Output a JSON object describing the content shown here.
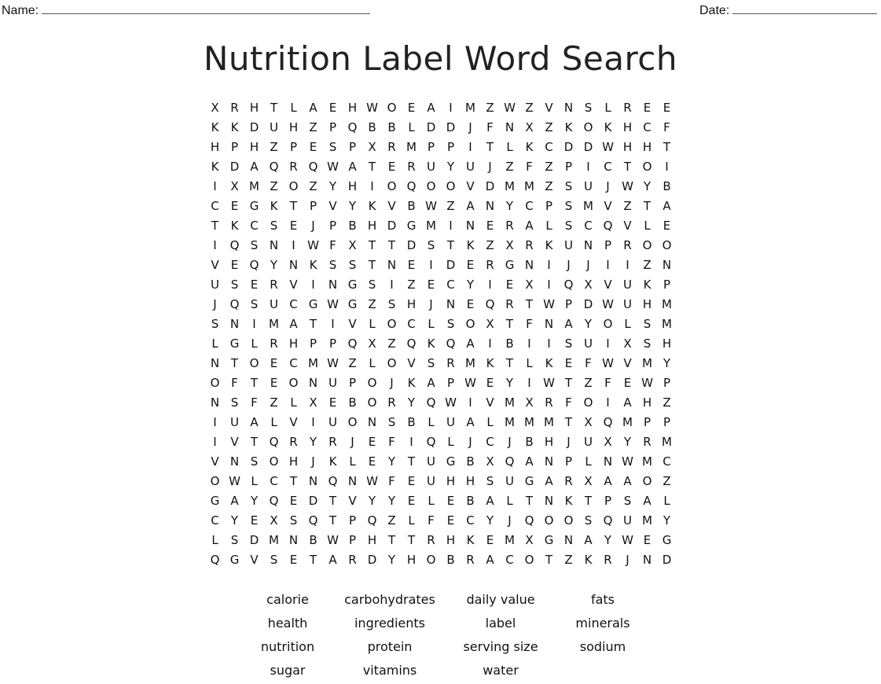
{
  "header": {
    "name_label": "Name:",
    "date_label": "Date:"
  },
  "title": "Nutrition Label Word Search",
  "grid": [
    "XRHTLAEHWOEAIMZWZVNSLREE",
    "KKDUHZPQBBLDDJFNXZKOKHCF",
    "HPHZPESPXRMPPITLKCDDWHHT",
    "KDAQRQWATERUYUJZFZPICTOI",
    "IXMZOZYHIOQOOVDMMZSUJWYB",
    "CEGKTPVYKVBWZANYCPSMVZTA",
    "TKCSEJPBHDGMINERALSCQVLE",
    "IQSNIWFXTTDSTKZXRKUNPROO",
    "VEQYNKSSTNEIDERGNIJJIIZN",
    "USERVINGSIZECYIEXIQXVUKP",
    "JQSUCGWGZSHJNEQRTWPDWUHM",
    "SNIMATIVLOCLSOXTFNAYOLSM",
    "LGLRHPPQXZQKQAIBIISUIXSH",
    "NTOECMWZLOVSRMKTLKEFWVMY",
    "OFTEONUPOJKAPWEYIWTZFEWP",
    "NSFZLXEBORYQWIVMXRFOIAHZ",
    "IUALVIUONSBLUALMMMTXQMPP",
    "IVTQRYRJEFIQLJCJBHJUXYRM",
    "VNSOHJKLEYTUGBXQANPLNWMC",
    "OWLCTNQNWFEUHHSUGARXAAOZ",
    "GAYQEDTVYYELEBALTNKTPSAL",
    "CYEXSQTPQZLFECYJQOOSQUMY",
    "LSDMNBWPHTTRHKEMXGNAYWEG",
    "QGVSETARDYHOBRACOTZKRJND"
  ],
  "word_list": [
    "calorie",
    "carbohydrates",
    "daily value",
    "fats",
    "health",
    "ingredients",
    "label",
    "minerals",
    "nutrition",
    "protein",
    "serving size",
    "sodium",
    "sugar",
    "vitamins",
    "water"
  ]
}
